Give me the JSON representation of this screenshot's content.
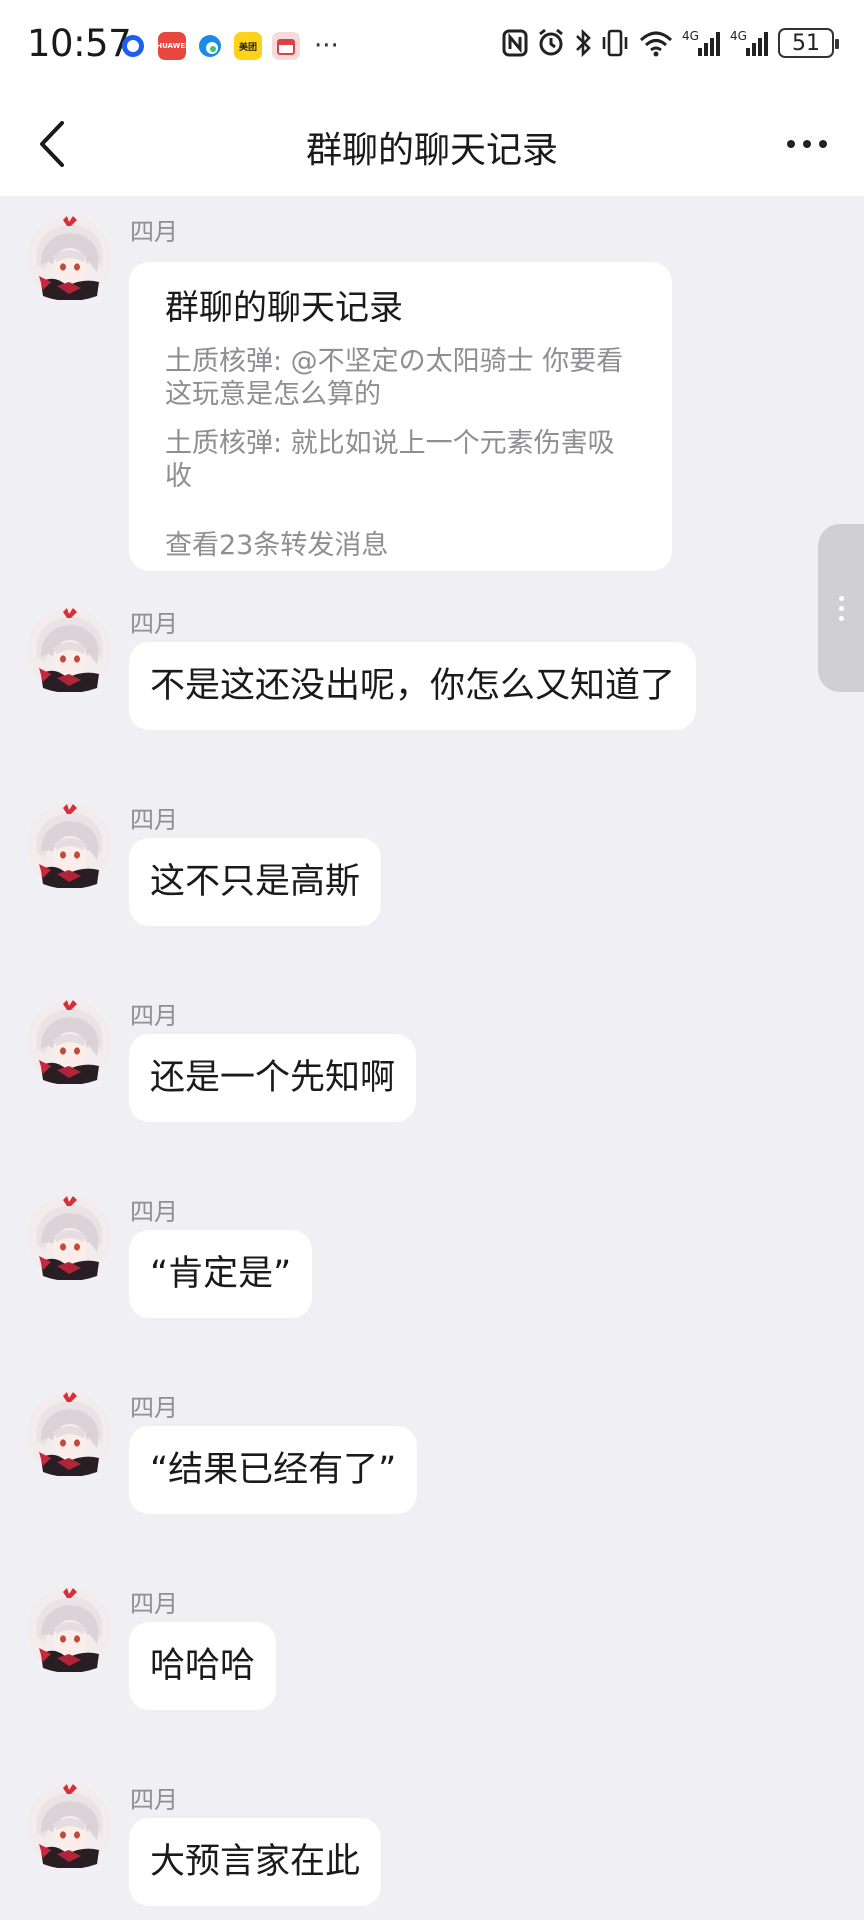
{
  "status_bar": {
    "time": "10:57",
    "app_icons": [
      "qq-browser-icon",
      "huawei-app-icon",
      "edge-icon",
      "meituan-icon",
      "calendar-icon"
    ],
    "app_icon_labels": {
      "huawei": "HUAWEI",
      "meituan": "美团"
    },
    "more": "···",
    "battery": "51"
  },
  "nav": {
    "title": "群聊的聊天记录"
  },
  "forwarded_card": {
    "sender": "四月",
    "title": "群聊的聊天记录",
    "lines": [
      "土质核弹: @不坚定の太阳骑士 你要看这玩意是怎么算的",
      "土质核弹: 就比如说上一个元素伤害吸收"
    ],
    "footer": "查看23条转发消息"
  },
  "messages": [
    {
      "sender": "四月",
      "text": "不是这还没出呢，你怎么又知道了"
    },
    {
      "sender": "四月",
      "text": "这不只是高斯"
    },
    {
      "sender": "四月",
      "text": "还是一个先知啊"
    },
    {
      "sender": "四月",
      "text": "“肯定是”"
    },
    {
      "sender": "四月",
      "text": "“结果已经有了”"
    },
    {
      "sender": "四月",
      "text": "哈哈哈"
    },
    {
      "sender": "四月",
      "text": "大预言家在此"
    }
  ]
}
